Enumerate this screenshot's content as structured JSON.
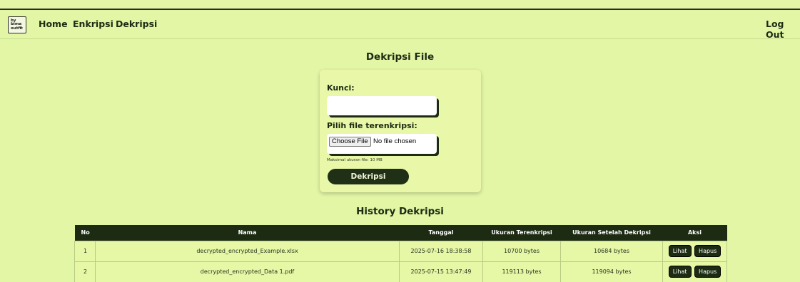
{
  "navbar": {
    "logo_lines": [
      "by",
      "bima",
      "outfit"
    ],
    "links": [
      "Home",
      "Enkripsi",
      "Dekripsi"
    ],
    "logout": "Log Out"
  },
  "page_title": "Dekripsi File",
  "form": {
    "key_label": "Kunci:",
    "key_value": "",
    "file_label": "Pilih file terenkripsi:",
    "choose_file": "Choose File",
    "no_file": "No file chosen",
    "hint": "Maksimal ukuran file: 10 MB",
    "submit": "Dekripsi"
  },
  "history": {
    "title": "History Dekripsi",
    "columns": [
      "No",
      "Nama",
      "Tanggal",
      "Ukuran Terenkripsi",
      "Ukuran Setelah Dekripsi",
      "Aksi"
    ],
    "rows": [
      {
        "no": "1",
        "nama": "decrypted_encrypted_Example.xlsx",
        "tanggal": "2025-07-16 18:38:58",
        "enc": "10700 bytes",
        "dec": "10684 bytes"
      },
      {
        "no": "2",
        "nama": "decrypted_encrypted_Data 1.pdf",
        "tanggal": "2025-07-15 13:47:49",
        "enc": "119113 bytes",
        "dec": "119094 bytes"
      }
    ],
    "actions": {
      "view": "Lihat",
      "delete": "Hapus"
    }
  },
  "colors": {
    "background": "#e3f6a6",
    "dark": "#1d2b13"
  }
}
